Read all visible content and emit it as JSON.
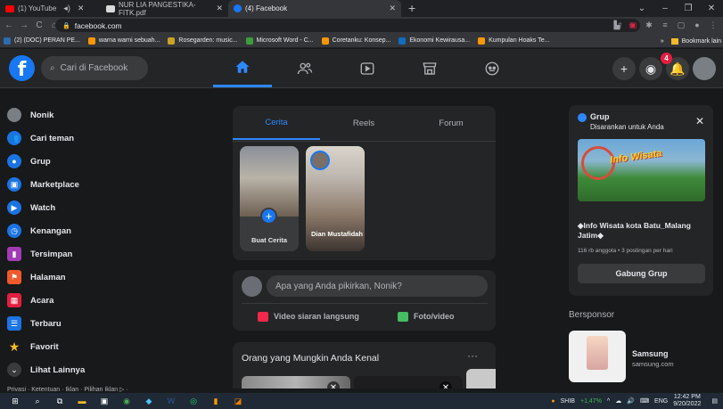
{
  "browser": {
    "tabs": [
      {
        "title": "(1) YouTube",
        "color": "#ff0000"
      },
      {
        "title": "NUR LIA PANGESTIKA-FITK.pdf",
        "color": "#d9d9d9"
      },
      {
        "title": "(4) Facebook",
        "color": "#1877f2"
      }
    ],
    "url": "facebook.com",
    "bookmarks": [
      {
        "label": "(2) (DOC) PERAN PE...",
        "color": "#2b6cb0"
      },
      {
        "label": "warna warni sebuah...",
        "color": "#ff9800"
      },
      {
        "label": "Rosegarden: music...",
        "color": "#c9a227"
      },
      {
        "label": "Microsoft Word - C...",
        "color": "#3c9d3c"
      },
      {
        "label": "Coretanku: Konsep...",
        "color": "#ff9800"
      },
      {
        "label": "Ekonomi Kewirausa...",
        "color": "#0f6fbf"
      },
      {
        "label": "Kumpulan Hoaks Te...",
        "color": "#ff9800"
      }
    ],
    "bookmarks_more": "»",
    "bookmarks_other": "Bookmark lain"
  },
  "header": {
    "logo": "f",
    "search_placeholder": "Cari di Facebook",
    "notification_count": "4"
  },
  "sidebar": {
    "items": [
      {
        "label": "Nonik",
        "color": "#7a7f86",
        "glyph": ""
      },
      {
        "label": "Cari teman",
        "color": "#1b74e4",
        "glyph": "👥"
      },
      {
        "label": "Grup",
        "color": "#1b74e4",
        "glyph": "●"
      },
      {
        "label": "Marketplace",
        "color": "#1b74e4",
        "glyph": "▣"
      },
      {
        "label": "Watch",
        "color": "#1b74e4",
        "glyph": "▶"
      },
      {
        "label": "Kenangan",
        "color": "#1b74e4",
        "glyph": "◷"
      },
      {
        "label": "Tersimpan",
        "color": "#a33ab5",
        "glyph": "▮"
      },
      {
        "label": "Halaman",
        "color": "#f0592a",
        "glyph": "⚑"
      },
      {
        "label": "Acara",
        "color": "#e41e3f",
        "glyph": "▦"
      },
      {
        "label": "Terbaru",
        "color": "#1b74e4",
        "glyph": "☰"
      },
      {
        "label": "Favorit",
        "color": "#f7b928",
        "glyph": "★"
      },
      {
        "label": "Lihat Lainnya",
        "color": "#3a3b3c",
        "glyph": "⌄"
      }
    ],
    "footer": "Privasi · Ketentuan · Iklan · Pilihan Iklan ▷ ·"
  },
  "stories": {
    "tabs": [
      "Cerita",
      "Reels",
      "Forum"
    ],
    "create_label": "Buat Cerita",
    "story_name": "Dian Mustafidah"
  },
  "composer": {
    "placeholder": "Apa yang Anda pikirkan, Nonik?",
    "live_label": "Video siaran langsung",
    "photo_label": "Foto/video",
    "live_color": "#f02849",
    "photo_color": "#45bd62"
  },
  "pymk": {
    "title": "Orang yang Mungkin Anda Kenal",
    "more": "···"
  },
  "group_suggestion": {
    "title": "Grup",
    "subtitle": "Disarankan untuk Anda",
    "banner_text": "Info Wisata",
    "name": "◆Info Wisata kota Batu_Malang Jatim◆",
    "meta": "116 rb anggota • 3 postingan per hari",
    "join_label": "Gabung Grup"
  },
  "sponsored": {
    "title": "Bersponsor",
    "advertiser": "Samsung",
    "url": "samsung.com"
  },
  "taskbar": {
    "ticker": "SHIB",
    "ticker_change": "+1,47%",
    "language": "ENG",
    "time": "12:42 PM",
    "date": "9/20/2022"
  }
}
